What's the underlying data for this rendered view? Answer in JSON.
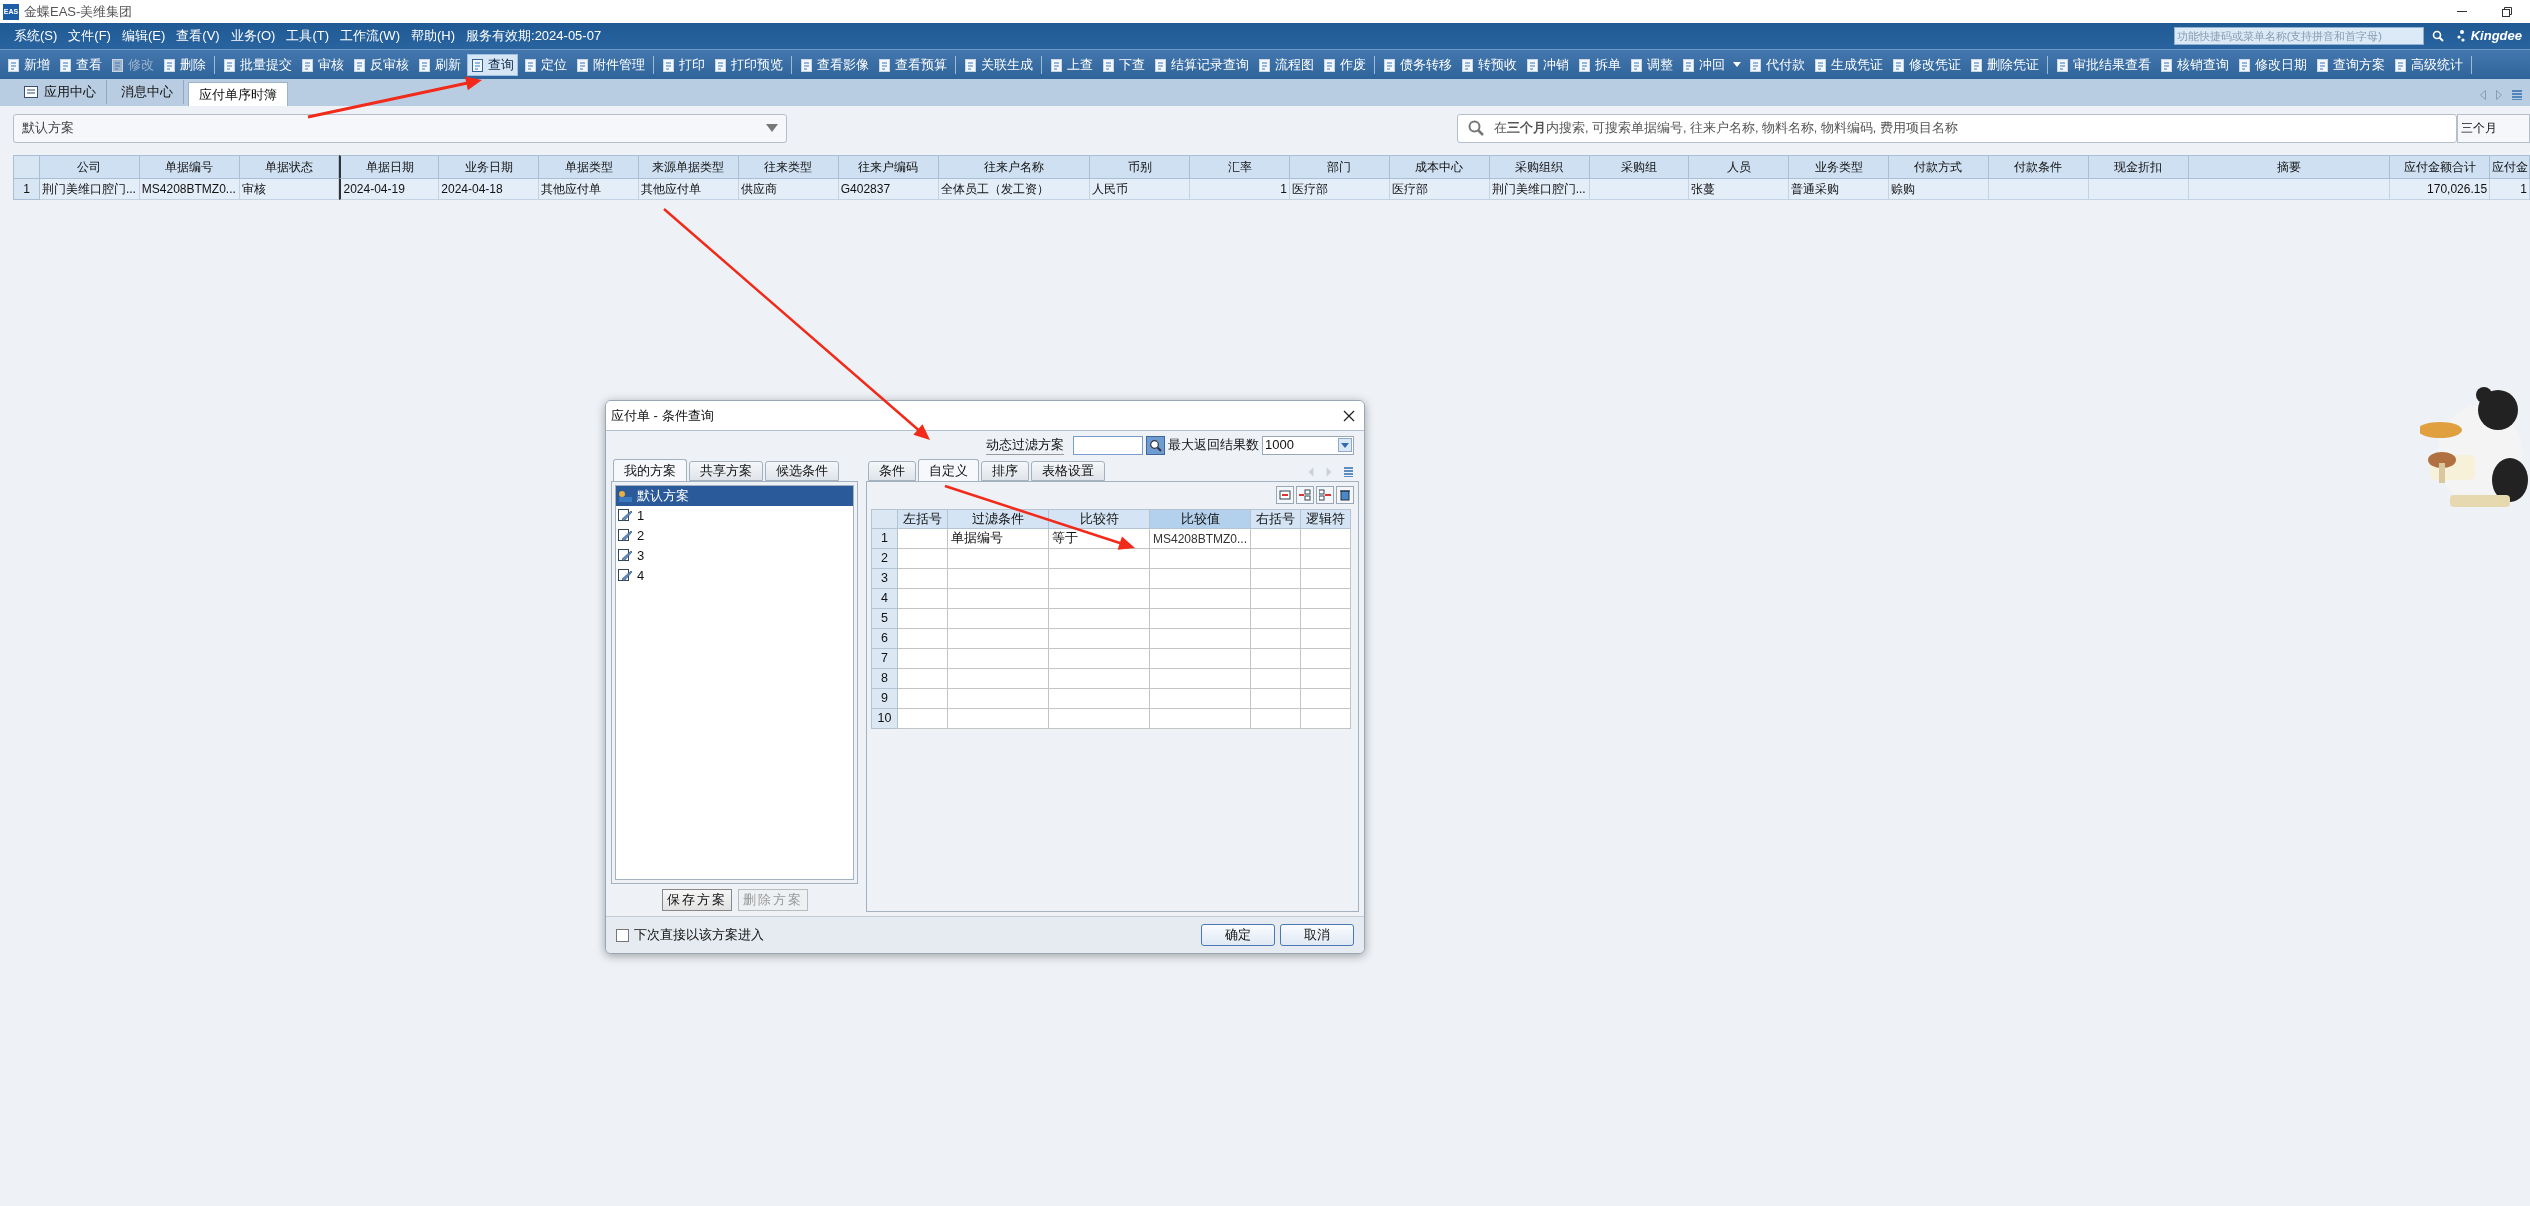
{
  "window": {
    "logo_text": "EAS",
    "title": "金蝶EAS-美维集团"
  },
  "menu": [
    {
      "label": "系统(S)"
    },
    {
      "label": "文件(F)"
    },
    {
      "label": "编辑(E)"
    },
    {
      "label": "查看(V)"
    },
    {
      "label": "业务(O)"
    },
    {
      "label": "工具(T)"
    },
    {
      "label": "工作流(W)"
    },
    {
      "label": "帮助(H)"
    }
  ],
  "service_expiry": "服务有效期:2024-05-07",
  "quick_search": {
    "placeholder": "功能快捷码或菜单名称(支持拼音和首字母)"
  },
  "brand": "Kingdee",
  "toolbar": [
    {
      "kind": "button",
      "label": "新增",
      "disabled": false,
      "pressed": false
    },
    {
      "kind": "button",
      "label": "查看",
      "disabled": false,
      "pressed": false
    },
    {
      "kind": "button",
      "label": "修改",
      "disabled": true,
      "pressed": false
    },
    {
      "kind": "button",
      "label": "删除",
      "disabled": false,
      "pressed": false
    },
    {
      "kind": "separator"
    },
    {
      "kind": "button",
      "label": "批量提交",
      "disabled": false,
      "pressed": false
    },
    {
      "kind": "button",
      "label": "审核",
      "disabled": false,
      "pressed": false
    },
    {
      "kind": "button",
      "label": "反审核",
      "disabled": false,
      "pressed": false
    },
    {
      "kind": "button",
      "label": "刷新",
      "disabled": false,
      "pressed": false
    },
    {
      "kind": "button",
      "label": "查询",
      "disabled": false,
      "pressed": true
    },
    {
      "kind": "button",
      "label": "定位",
      "disabled": false,
      "pressed": false
    },
    {
      "kind": "button",
      "label": "附件管理",
      "disabled": false,
      "pressed": false
    },
    {
      "kind": "separator"
    },
    {
      "kind": "button",
      "label": "打印",
      "disabled": false,
      "pressed": false
    },
    {
      "kind": "button",
      "label": "打印预览",
      "disabled": false,
      "pressed": false
    },
    {
      "kind": "separator"
    },
    {
      "kind": "button",
      "label": "查看影像",
      "disabled": false,
      "pressed": false
    },
    {
      "kind": "button",
      "label": "查看预算",
      "disabled": false,
      "pressed": false
    },
    {
      "kind": "separator"
    },
    {
      "kind": "button",
      "label": "关联生成",
      "disabled": false,
      "pressed": false
    },
    {
      "kind": "separator"
    },
    {
      "kind": "button",
      "label": "上查",
      "disabled": false,
      "pressed": false
    },
    {
      "kind": "button",
      "label": "下查",
      "disabled": false,
      "pressed": false
    },
    {
      "kind": "button",
      "label": "结算记录查询",
      "disabled": false,
      "pressed": false
    },
    {
      "kind": "button",
      "label": "流程图",
      "disabled": false,
      "pressed": false
    },
    {
      "kind": "button",
      "label": "作废",
      "disabled": false,
      "pressed": false
    },
    {
      "kind": "separator"
    },
    {
      "kind": "button",
      "label": "债务转移",
      "disabled": false,
      "pressed": false
    },
    {
      "kind": "button",
      "label": "转预收",
      "disabled": false,
      "pressed": false
    },
    {
      "kind": "button",
      "label": "冲销",
      "disabled": false,
      "pressed": false
    },
    {
      "kind": "button",
      "label": "拆单",
      "disabled": false,
      "pressed": false
    },
    {
      "kind": "button",
      "label": "调整",
      "disabled": false,
      "pressed": false
    },
    {
      "kind": "button",
      "label": "冲回",
      "disabled": false,
      "pressed": false
    },
    {
      "kind": "caret"
    },
    {
      "kind": "button",
      "label": "代付款",
      "disabled": false,
      "pressed": false
    },
    {
      "kind": "button",
      "label": "生成凭证",
      "disabled": false,
      "pressed": false
    },
    {
      "kind": "button",
      "label": "修改凭证",
      "disabled": false,
      "pressed": false
    },
    {
      "kind": "button",
      "label": "删除凭证",
      "disabled": false,
      "pressed": false
    },
    {
      "kind": "separator"
    },
    {
      "kind": "button",
      "label": "审批结果查看",
      "disabled": false,
      "pressed": false
    },
    {
      "kind": "button",
      "label": "核销查询",
      "disabled": false,
      "pressed": false
    },
    {
      "kind": "button",
      "label": "修改日期",
      "disabled": false,
      "pressed": false
    },
    {
      "kind": "button",
      "label": "查询方案",
      "disabled": false,
      "pressed": false
    },
    {
      "kind": "button",
      "label": "高级统计",
      "disabled": false,
      "pressed": false
    },
    {
      "kind": "separator"
    }
  ],
  "tabs": [
    {
      "label": "应用中心",
      "selected": false,
      "icon": true
    },
    {
      "label": "消息中心",
      "selected": false,
      "icon": false
    },
    {
      "label": "应付单序时簿",
      "selected": true,
      "icon": false
    }
  ],
  "scheme_select": {
    "value": "默认方案"
  },
  "search": {
    "placeholder": "在**三个月**内搜索, 可搜索单据编号, 往来户名称, 物料名称, 物料编码, 费用项目名称"
  },
  "range_button": "三个月",
  "table": {
    "columns": [
      {
        "label": "公司",
        "kind": "text"
      },
      {
        "label": "单据编号",
        "kind": "text"
      },
      {
        "label": "单据状态",
        "kind": "text"
      },
      {
        "label": "单据日期",
        "kind": "text"
      },
      {
        "label": "业务日期",
        "kind": "text"
      },
      {
        "label": "单据类型",
        "kind": "text"
      },
      {
        "label": "来源单据类型",
        "kind": "text"
      },
      {
        "label": "往来类型",
        "kind": "text"
      },
      {
        "label": "往来户编码",
        "kind": "text"
      },
      {
        "label": "往来户名称",
        "kind": "text"
      },
      {
        "label": "币别",
        "kind": "text"
      },
      {
        "label": "汇率",
        "kind": "number"
      },
      {
        "label": "部门",
        "kind": "text"
      },
      {
        "label": "成本中心",
        "kind": "text"
      },
      {
        "label": "采购组织",
        "kind": "text"
      },
      {
        "label": "采购组",
        "kind": "text"
      },
      {
        "label": "人员",
        "kind": "text"
      },
      {
        "label": "业务类型",
        "kind": "text"
      },
      {
        "label": "付款方式",
        "kind": "text"
      },
      {
        "label": "付款条件",
        "kind": "text"
      },
      {
        "label": "现金折扣",
        "kind": "text"
      },
      {
        "label": "摘要",
        "kind": "text"
      },
      {
        "label": "应付金额合计",
        "kind": "number"
      },
      {
        "label": "应付金",
        "kind": "number"
      }
    ],
    "rows": [
      {
        "number": "1",
        "selected": true,
        "cells": [
          {
            "text": "荆门美维口腔门..."
          },
          {
            "text": "MS4208BTMZ0..."
          },
          {
            "text": "审核"
          },
          {
            "text": "2024-04-19"
          },
          {
            "text": "2024-04-18"
          },
          {
            "text": "其他应付单"
          },
          {
            "text": "其他应付单"
          },
          {
            "text": "供应商"
          },
          {
            "text": "G402837"
          },
          {
            "text": "全体员工（发工资）"
          },
          {
            "text": "人民币"
          },
          {
            "text": "1"
          },
          {
            "text": "医疗部"
          },
          {
            "text": "医疗部"
          },
          {
            "text": "荆门美维口腔门..."
          },
          {},
          {
            "text": "张蔓"
          },
          {
            "text": "普通采购"
          },
          {
            "text": "赊购"
          },
          {},
          {},
          {},
          {
            "text": "170,026.15"
          },
          {
            "text": "1"
          }
        ]
      }
    ]
  },
  "dialog": {
    "title": "应付单 - 条件查询",
    "filter_label": "动态过滤方案",
    "max_label": "最大返回结果数",
    "max_value": "1000",
    "scheme_tabs": [
      {
        "label": "我的方案",
        "selected": true
      },
      {
        "label": "共享方案",
        "selected": false
      },
      {
        "label": "候选条件",
        "selected": false
      }
    ],
    "schemes": [
      {
        "label": "默认方案",
        "selected": true,
        "kind": "default"
      },
      {
        "label": "1",
        "selected": false,
        "kind": "custom"
      },
      {
        "label": "2",
        "selected": false,
        "kind": "custom"
      },
      {
        "label": "3",
        "selected": false,
        "kind": "custom"
      },
      {
        "label": "4",
        "selected": false,
        "kind": "custom"
      }
    ],
    "save_button": {
      "label": "保存方案",
      "disabled": false
    },
    "delete_button": {
      "label": "删除方案",
      "disabled": true
    },
    "condition_tabs": [
      {
        "label": "条件",
        "selected": false
      },
      {
        "label": "自定义",
        "selected": true
      },
      {
        "label": "排序",
        "selected": false
      },
      {
        "label": "表格设置",
        "selected": false
      }
    ],
    "grid": {
      "columns": [
        {
          "label": "左括号",
          "selected": false
        },
        {
          "label": "过滤条件",
          "selected": false
        },
        {
          "label": "比较符",
          "selected": false
        },
        {
          "label": "比较值",
          "selected": true
        },
        {
          "label": "右括号",
          "selected": false
        },
        {
          "label": "逻辑符",
          "selected": false
        }
      ],
      "rows": [
        {
          "number": "1",
          "cells": [
            {},
            {
              "text": "单据编号"
            },
            {
              "text": "等于"
            },
            {
              "text": "MS4208BTMZ0..."
            },
            {},
            {}
          ]
        },
        {
          "number": "2"
        },
        {
          "number": "3"
        },
        {
          "number": "4"
        },
        {
          "number": "5"
        },
        {
          "number": "6"
        },
        {
          "number": "7"
        },
        {
          "number": "8"
        },
        {
          "number": "9"
        },
        {
          "number": "10"
        }
      ]
    },
    "remember": {
      "label": "下次直接以该方案进入",
      "checked": false
    },
    "ok_button": "确定",
    "cancel_button": "取消"
  }
}
